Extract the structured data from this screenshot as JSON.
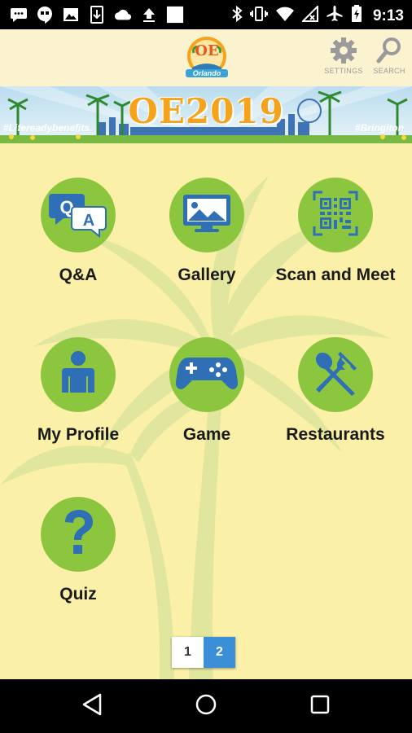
{
  "status_bar": {
    "time": "9:13",
    "left_icons": [
      "message-icon",
      "hangouts-icon",
      "image-icon",
      "download-icon",
      "cloud-icon",
      "upload-icon",
      "blank-square-icon"
    ],
    "right_icons": [
      "bluetooth-icon",
      "vibrate-icon",
      "wifi-icon",
      "no-signal-icon",
      "airplane-mode-icon",
      "battery-charging-icon"
    ]
  },
  "app_bar": {
    "logo_text": "OE",
    "logo_subtext": "Orlando",
    "settings_label": "SETTINGS",
    "search_label": "SEARCH"
  },
  "banner": {
    "title": "OE2019",
    "tag_left": "#Lifereadybenefits",
    "tag_right": "#Bringiton"
  },
  "tiles": [
    {
      "label": "Q&A",
      "icon": "qa-chat-icon"
    },
    {
      "label": "Gallery",
      "icon": "image-gallery-icon"
    },
    {
      "label": "Scan and Meet",
      "icon": "qr-code-icon"
    },
    {
      "label": "My Profile",
      "icon": "person-icon"
    },
    {
      "label": "Game",
      "icon": "gamepad-icon"
    },
    {
      "label": "Restaurants",
      "icon": "fork-spoon-icon"
    },
    {
      "label": "Quiz",
      "icon": "question-mark-icon"
    }
  ],
  "pagination": {
    "pages": [
      "1",
      "2"
    ],
    "current": "2"
  },
  "nav_bar": {
    "buttons": [
      "back-icon",
      "home-icon",
      "recents-icon"
    ]
  },
  "colors": {
    "tile_circle": "#8cc63f",
    "icon_blue": "#2e6fb5",
    "background": "#fbf0a8",
    "active_page": "#3a8fd6"
  }
}
